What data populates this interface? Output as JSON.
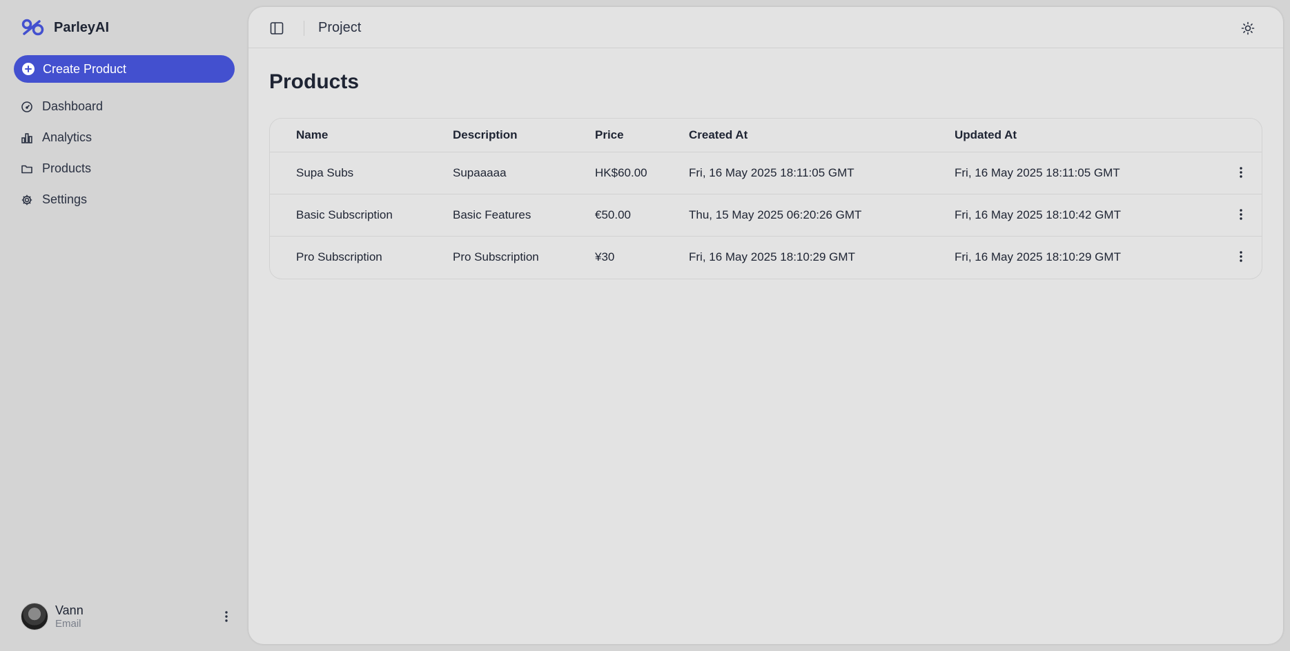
{
  "brand": {
    "name": "ParleyAI",
    "accent": "#4350cf"
  },
  "sidebar": {
    "create_label": "Create Product",
    "items": [
      {
        "label": "Dashboard",
        "icon": "gauge-icon"
      },
      {
        "label": "Analytics",
        "icon": "bar-chart-icon"
      },
      {
        "label": "Products",
        "icon": "folder-icon"
      },
      {
        "label": "Settings",
        "icon": "gear-icon"
      }
    ]
  },
  "user": {
    "name": "Vann",
    "email": "Email"
  },
  "header": {
    "title": "Project"
  },
  "page": {
    "title": "Products"
  },
  "table": {
    "columns": [
      "Name",
      "Description",
      "Price",
      "Created At",
      "Updated At"
    ],
    "rows": [
      {
        "name": "Supa Subs",
        "description": "Supaaaaa",
        "price": "HK$60.00",
        "created": "Fri, 16 May 2025 18:11:05 GMT",
        "updated": "Fri, 16 May 2025 18:11:05 GMT"
      },
      {
        "name": "Basic Subscription",
        "description": "Basic Features",
        "price": "€50.00",
        "created": "Thu, 15 May 2025 06:20:26 GMT",
        "updated": "Fri, 16 May 2025 18:10:42 GMT"
      },
      {
        "name": "Pro Subscription",
        "description": "Pro Subscription",
        "price": "¥30",
        "created": "Fri, 16 May 2025 18:10:29 GMT",
        "updated": "Fri, 16 May 2025 18:10:29 GMT"
      }
    ]
  }
}
